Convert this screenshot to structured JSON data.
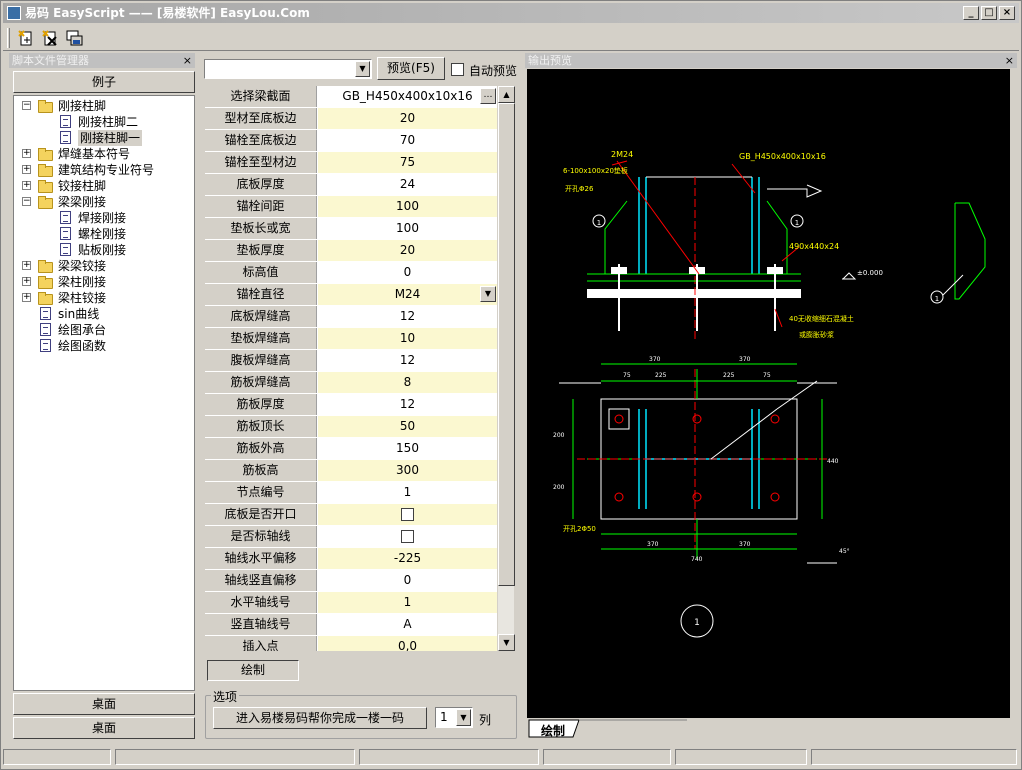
{
  "window": {
    "title": "易码 EasyScript —— [易楼软件] EasyLou.Com",
    "min": "_",
    "max": "□",
    "close": "×"
  },
  "toolbar": {
    "buttons": [
      {
        "icon": "new-script-icon"
      },
      {
        "icon": "delete-script-icon"
      },
      {
        "icon": "save-icon"
      }
    ]
  },
  "left_panel": {
    "title": "脚本文件管理器",
    "close": "×",
    "examples_label": "例子",
    "desktop_label_1": "桌面",
    "desktop_label_2": "桌面"
  },
  "tree": [
    {
      "label": "刚接柱脚",
      "type": "folder",
      "expanded": true,
      "level": 0
    },
    {
      "label": "刚接柱脚二",
      "type": "doc",
      "level": 1
    },
    {
      "label": "刚接柱脚一",
      "type": "doc",
      "level": 1,
      "selected": true
    },
    {
      "label": "焊缝基本符号",
      "type": "folder",
      "expanded": false,
      "level": 0
    },
    {
      "label": "建筑结构专业符号",
      "type": "folder",
      "expanded": false,
      "level": 0
    },
    {
      "label": "铰接柱脚",
      "type": "folder",
      "expanded": false,
      "level": 0
    },
    {
      "label": "梁梁刚接",
      "type": "folder",
      "expanded": true,
      "level": 0
    },
    {
      "label": "焊接刚接",
      "type": "doc",
      "level": 1
    },
    {
      "label": "螺栓刚接",
      "type": "doc",
      "level": 1
    },
    {
      "label": "贴板刚接",
      "type": "doc",
      "level": 1
    },
    {
      "label": "梁梁铰接",
      "type": "folder",
      "expanded": false,
      "level": 0
    },
    {
      "label": "梁柱刚接",
      "type": "folder",
      "expanded": false,
      "level": 0
    },
    {
      "label": "梁柱铰接",
      "type": "folder",
      "expanded": false,
      "level": 0
    },
    {
      "label": "sin曲线",
      "type": "doc",
      "level": 0
    },
    {
      "label": "绘图承台",
      "type": "doc",
      "level": 0
    },
    {
      "label": "绘图函数",
      "type": "doc",
      "level": 0
    }
  ],
  "middle": {
    "script_combo": "",
    "preview_button": "预览(F5)",
    "auto_preview": "自动预览",
    "draw_button": "绘制",
    "options_label": "选项",
    "enter_button": "进入易楼易码帮你完成一楼一码",
    "columns_value": "1",
    "columns_unit": "列"
  },
  "properties": [
    {
      "name": "选择梁截面",
      "value": "GB_H450x400x10x16",
      "kind": "browse"
    },
    {
      "name": "型材至底板边",
      "value": "20"
    },
    {
      "name": "锚栓至底板边",
      "value": "70"
    },
    {
      "name": "锚栓至型材边",
      "value": "75"
    },
    {
      "name": "底板厚度",
      "value": "24"
    },
    {
      "name": "锚栓间距",
      "value": "100"
    },
    {
      "name": "垫板长或宽",
      "value": "100"
    },
    {
      "name": "垫板厚度",
      "value": "20"
    },
    {
      "name": "标高值",
      "value": "0"
    },
    {
      "name": "锚栓直径",
      "value": "M24",
      "kind": "dropdown"
    },
    {
      "name": "底板焊缝高",
      "value": "12"
    },
    {
      "name": "垫板焊缝高",
      "value": "10"
    },
    {
      "name": "腹板焊缝高",
      "value": "12"
    },
    {
      "name": "筋板焊缝高",
      "value": "8"
    },
    {
      "name": "筋板厚度",
      "value": "12"
    },
    {
      "name": "筋板顶长",
      "value": "50"
    },
    {
      "name": "筋板外高",
      "value": "150"
    },
    {
      "name": "筋板高",
      "value": "300"
    },
    {
      "name": "节点编号",
      "value": "1"
    },
    {
      "name": "底板是否开口",
      "value": "",
      "kind": "checkbox"
    },
    {
      "name": "是否标轴线",
      "value": "",
      "kind": "checkbox"
    },
    {
      "name": "轴线水平偏移",
      "value": "-225"
    },
    {
      "name": "轴线竖直偏移",
      "value": "0"
    },
    {
      "name": "水平轴线号",
      "value": "1"
    },
    {
      "name": "竖直轴线号",
      "value": "A"
    },
    {
      "name": "插入点",
      "value": "0,0"
    }
  ],
  "right_panel": {
    "title": "输出预览",
    "close": "×",
    "tab": "绘制"
  },
  "drawing": {
    "labels": {
      "bolt": "2M24",
      "section": "GB_H450x400x10x16",
      "pad": "6-100x100x20垫板",
      "hole": "开孔Φ26",
      "plate": "490x440x24",
      "grout1": "40无收缩细石混凝土",
      "grout2": "或膨胀砂浆",
      "elev": "±0.000",
      "node": "1",
      "holes2": "开孔2Φ50",
      "angle": "45°",
      "section_tag": "1",
      "d370": "370",
      "d75": "75",
      "d225": "225",
      "d440": "440",
      "d740": "740",
      "d200": "200"
    }
  },
  "colors": {
    "cad_bg": "#000000",
    "cad_green": "#00ff00",
    "cad_cyan": "#00e5ff",
    "cad_red": "#ff0000",
    "cad_yellow": "#ffff00",
    "cad_white": "#ffffff",
    "grid_alt": "#fbf8d0"
  }
}
